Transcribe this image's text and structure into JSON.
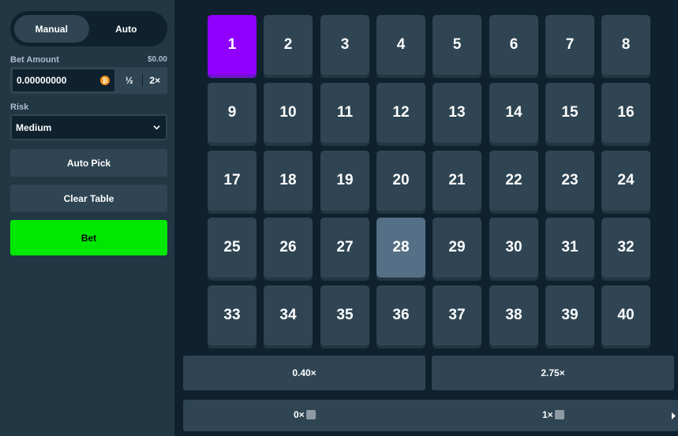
{
  "sidebar": {
    "mode_tabs": [
      "Manual",
      "Auto"
    ],
    "active_mode": "Manual",
    "bet_amount": {
      "label": "Bet Amount",
      "usd_value": "$0.00",
      "value": "0.00000000",
      "currency_icon": "bitcoin-icon",
      "half_label": "½",
      "double_label": "2×"
    },
    "risk": {
      "label": "Risk",
      "value": "Medium"
    },
    "auto_pick_label": "Auto Pick",
    "clear_table_label": "Clear Table",
    "bet_label": "Bet"
  },
  "grid": {
    "tiles": [
      "1",
      "2",
      "3",
      "4",
      "5",
      "6",
      "7",
      "8",
      "9",
      "10",
      "11",
      "12",
      "13",
      "14",
      "15",
      "16",
      "17",
      "18",
      "19",
      "20",
      "21",
      "22",
      "23",
      "24",
      "25",
      "26",
      "27",
      "28",
      "29",
      "30",
      "31",
      "32",
      "33",
      "34",
      "35",
      "36",
      "37",
      "38",
      "39",
      "40"
    ],
    "selected": [
      "1"
    ],
    "hovered": "28"
  },
  "payouts": [
    "0.40×",
    "2.75×"
  ],
  "hits": [
    {
      "label": "0×",
      "icon": "gem-icon"
    },
    {
      "label": "1×",
      "icon": "gem-icon"
    }
  ],
  "colors": {
    "background": "#0f212e",
    "panel": "#213743",
    "tile": "#2f4553",
    "selected": "#9000ff",
    "hover": "#557086",
    "bet_button": "#00e701"
  }
}
